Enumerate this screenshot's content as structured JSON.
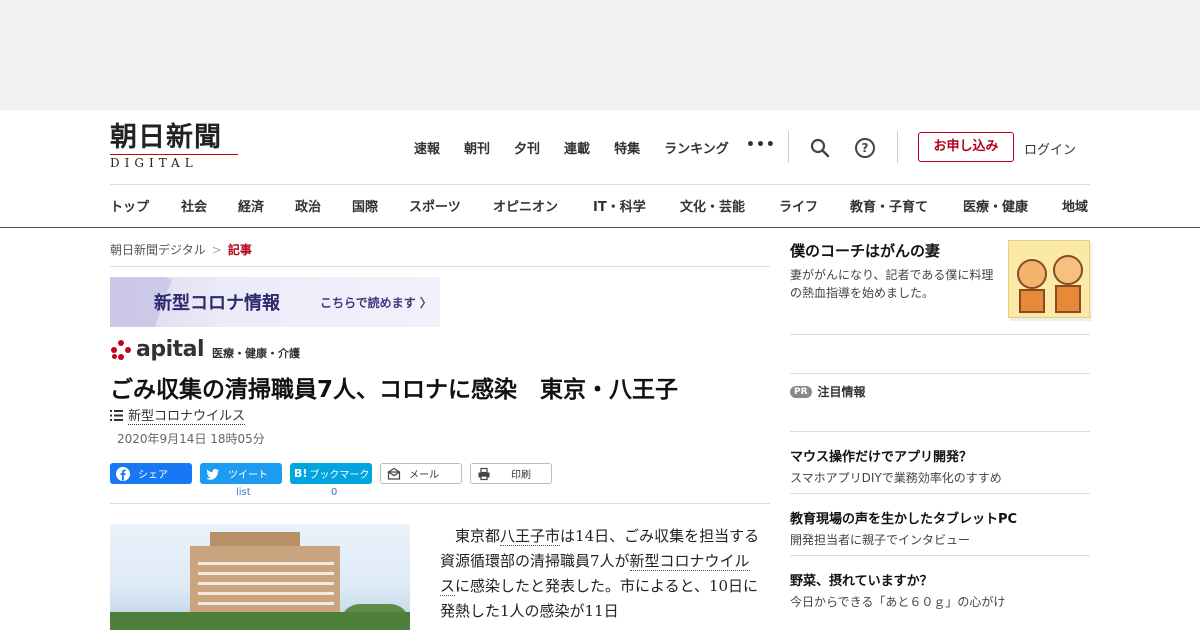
{
  "logo": {
    "main": "朝日新聞",
    "sub": "DIGITAL"
  },
  "topnav": [
    "速報",
    "朝刊",
    "夕刊",
    "連載",
    "特集",
    "ランキング"
  ],
  "header": {
    "apply": "お申し込み",
    "login": "ログイン",
    "help": "?"
  },
  "categories": [
    "トップ",
    "社会",
    "経済",
    "政治",
    "国際",
    "スポーツ",
    "オピニオン",
    "IT・科学",
    "文化・芸能",
    "ライフ",
    "教育・子育て",
    "医療・健康",
    "地域"
  ],
  "breadcrumb": {
    "home": "朝日新聞デジタル",
    "sep": ">",
    "current": "記事"
  },
  "banner": {
    "title": "新型コロナ情報",
    "link": "こちらで読めます 〉"
  },
  "apital": {
    "word": "apital",
    "category": "医療・健康・介護"
  },
  "article": {
    "headline": "ごみ収集の清掃職員7人、コロナに感染　東京・八王子",
    "topic": "新型コロナウイルス",
    "date": "2020年9月14日 18時05分",
    "body": {
      "p1": "　東京都",
      "link1": "八王子市",
      "p2": "は14日、ごみ収集を担当する資源循環部の清掃職員7人が",
      "link2": "新型コロナウイルス",
      "p3": "に感染したと発表した。市によると、10日に発熱した1人の感染が11日"
    }
  },
  "share": {
    "facebook": "シェア",
    "twitter": "ツイート",
    "twitter_count": "list",
    "hatena": "ブックマーク",
    "hatena_badge": "B!",
    "hatena_count": "0",
    "mail": "メール",
    "print": "印刷"
  },
  "sidebar": {
    "feature": {
      "title": "僕のコーチはがんの妻",
      "desc": "妻ががんになり、記者である僕に料理の熱血指導を始めました。"
    },
    "pr_badge": "PR",
    "pr_label": "注目情報",
    "ads": [
      {
        "title": "マウス操作だけでアプリ開発？",
        "desc": "スマホアプリDIYで業務効率化のすすめ"
      },
      {
        "title": "教育現場の声を生かしたタブレットPC",
        "desc": "開発担当者に親子でインタビュー"
      },
      {
        "title": "野菜、摂れていますか？",
        "desc": "今日からできる「あと６０ｇ」の心がけ"
      }
    ]
  },
  "colors": {
    "accent": "#b5001c",
    "facebook": "#1877f2",
    "twitter": "#1d9bf0",
    "hatena": "#00a4de"
  }
}
